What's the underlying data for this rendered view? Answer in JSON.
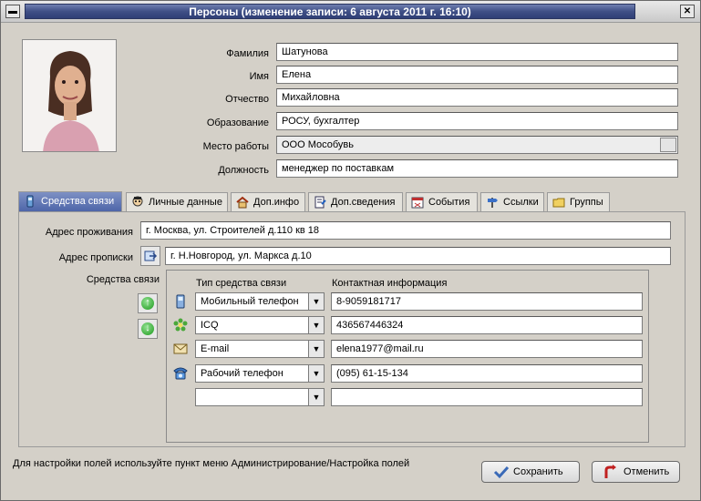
{
  "window": {
    "title": "Персоны  (изменение записи: 6 августа 2011 г. 16:10)"
  },
  "person": {
    "labels": {
      "lastname": "Фамилия",
      "firstname": "Имя",
      "patronymic": "Отчество",
      "education": "Образование",
      "workplace": "Место работы",
      "position": "Должность"
    },
    "values": {
      "lastname": "Шатунова",
      "firstname": "Елена",
      "patronymic": "Михайловна",
      "education": "РОСУ, бухгалтер",
      "workplace": "ООО Мособувь",
      "position": "менеджер по поставкам"
    }
  },
  "tabs": [
    {
      "label": "Средства связи",
      "icon": "mobile-phone-icon"
    },
    {
      "label": "Личные данные",
      "icon": "person-icon"
    },
    {
      "label": "Доп.инфо",
      "icon": "home-icon"
    },
    {
      "label": "Доп.сведения",
      "icon": "document-icon"
    },
    {
      "label": "События",
      "icon": "calendar-icon"
    },
    {
      "label": "Ссылки",
      "icon": "signpost-icon"
    },
    {
      "label": "Группы",
      "icon": "folder-icon"
    }
  ],
  "address": {
    "residence_label": "Адрес проживания",
    "residence_value": "г. Москва, ул. Строителей д.110 кв 18",
    "registration_label": "Адрес прописки",
    "registration_value": "г. Н.Новгород, ул. Маркса д.10"
  },
  "contacts": {
    "section_label": "Средства связи",
    "col_type": "Тип средства связи",
    "col_info": "Контактная информация",
    "rows": [
      {
        "type": "Мобильный телефон",
        "value": "8-9059181717",
        "icon": "mobile-phone-icon"
      },
      {
        "type": "ICQ",
        "value": "436567446324",
        "icon": "icq-flower-icon"
      },
      {
        "type": "E-mail",
        "value": "elena1977@mail.ru",
        "icon": "envelope-icon"
      },
      {
        "type": "Рабочий телефон",
        "value": "(095) 61-15-134",
        "icon": "desk-phone-icon"
      },
      {
        "type": "",
        "value": "",
        "icon": ""
      }
    ]
  },
  "status_text": "Для настройки полей используйте пункт меню Администрирование/Настройка полей",
  "buttons": {
    "save": "Сохранить",
    "cancel": "Отменить"
  },
  "colors": {
    "title_bar": "#3f4f86",
    "active_tab": "#5a70b0",
    "window_bg": "#d4d0c8"
  }
}
